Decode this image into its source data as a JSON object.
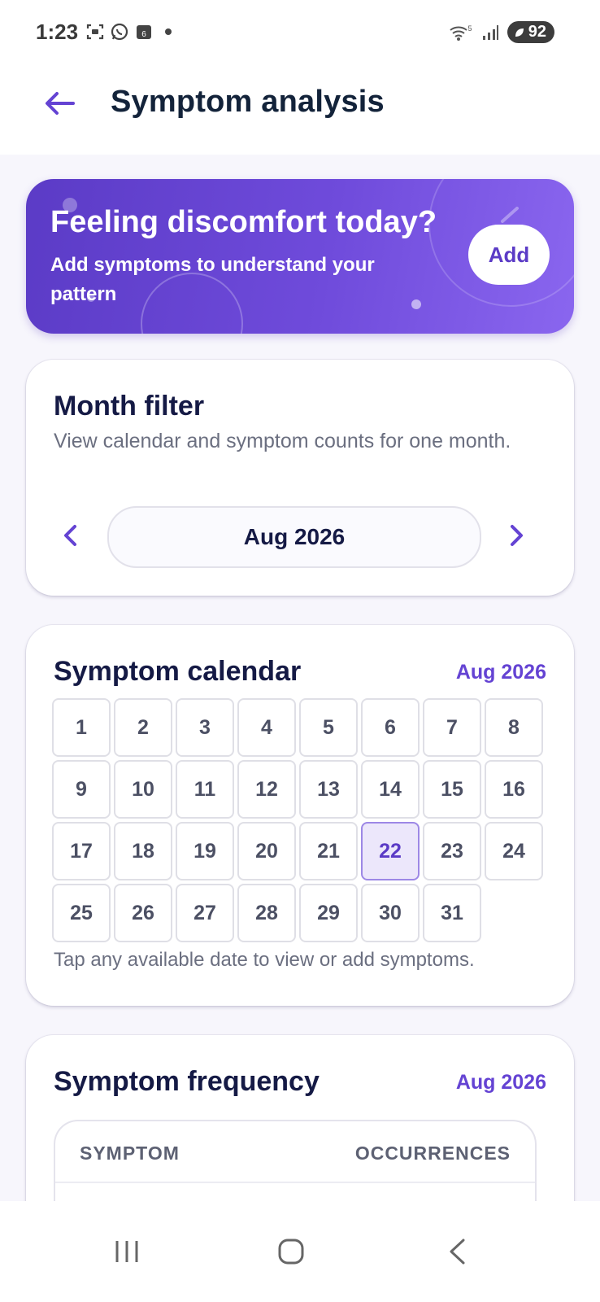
{
  "status_bar": {
    "time": "1:23",
    "left_icons": [
      "screenshot-icon",
      "whatsapp-icon",
      "calendar-icon",
      "dot-icon"
    ],
    "calendar_badge": "6",
    "right_icons": [
      "wifi-icon",
      "signal-icon"
    ],
    "wifi_label": "5",
    "battery": "92"
  },
  "app_bar": {
    "back_icon": "arrow-left-icon",
    "title": "Symptom analysis"
  },
  "banner": {
    "title": "Feeling discomfort today?",
    "subtitle": "Add symptoms to understand your pattern",
    "add_label": "Add"
  },
  "month_filter": {
    "title": "Month filter",
    "subtitle": "View calendar and symptom counts for one month.",
    "selected_month": "Aug 2026",
    "prev_icon": "chevron-left-icon",
    "next_icon": "chevron-right-icon"
  },
  "symptom_calendar": {
    "title": "Symptom calendar",
    "month": "Aug 2026",
    "days": [
      "1",
      "2",
      "3",
      "4",
      "5",
      "6",
      "7",
      "8",
      "9",
      "10",
      "11",
      "12",
      "13",
      "14",
      "15",
      "16",
      "17",
      "18",
      "19",
      "20",
      "21",
      "22",
      "23",
      "24",
      "25",
      "26",
      "27",
      "28",
      "29",
      "30",
      "31"
    ],
    "selected_day": "22",
    "hint": "Tap any available date to view or add symptoms."
  },
  "symptom_frequency": {
    "title": "Symptom frequency",
    "month": "Aug 2026",
    "columns": [
      "SYMPTOM",
      "OCCURRENCES"
    ]
  },
  "nav_bar": {
    "items": [
      "recent-apps-icon",
      "home-icon",
      "back-icon"
    ]
  },
  "colors": {
    "accent": "#6443d3",
    "banner_start": "#5b3bc6",
    "banner_end": "#8a66ef",
    "selected_day_bg": "#ece7fb",
    "background": "#f7f6fc"
  }
}
